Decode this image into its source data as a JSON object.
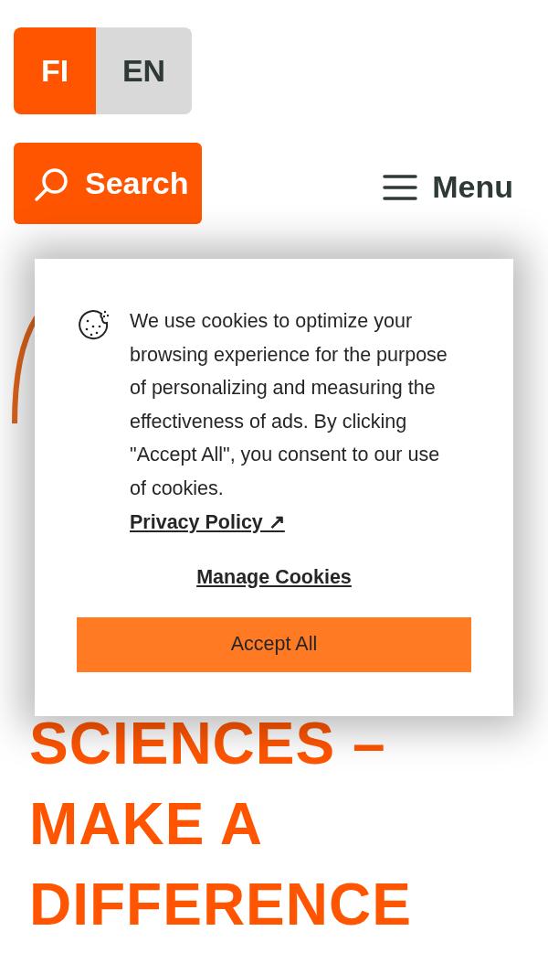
{
  "language_switch": [
    {
      "label": "FI",
      "selected": true
    },
    {
      "label": "EN",
      "selected": false
    }
  ],
  "search_button": "Search",
  "menu_button": "Menu",
  "hero_heading": [
    "SCIENCES –",
    "MAKE A",
    "DIFFERENCE"
  ],
  "cookie_dialog": {
    "message": "We use cookies to optimize your browsing experience for the purpose of personalizing and measuring the effectiveness of ads. By clicking \"Accept All\", you consent to our use of cookies.",
    "privacy_link": "Privacy Policy ↗",
    "manage_link": "Manage Cookies",
    "accept_button": "Accept All"
  }
}
